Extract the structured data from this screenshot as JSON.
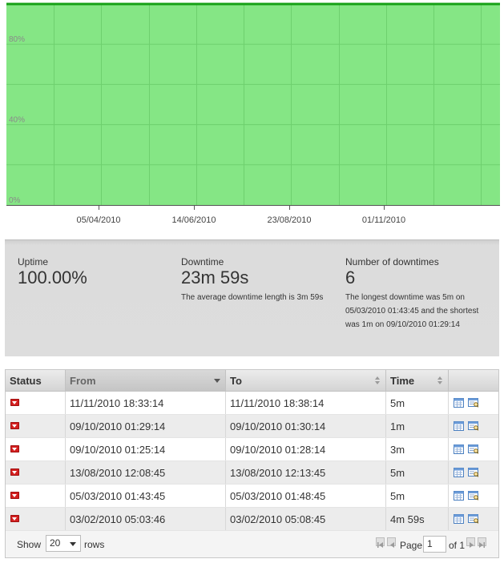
{
  "chart_data": {
    "type": "area",
    "x": [
      "start",
      "end"
    ],
    "series": [
      {
        "values": [
          100,
          100
        ]
      }
    ],
    "ylim": [
      0,
      100
    ],
    "y_ticks": [
      "0%",
      "40%",
      "80%"
    ],
    "x_ticks": [
      "05/04/2010",
      "14/06/2010",
      "23/08/2010",
      "01/11/2010"
    ],
    "grid": true,
    "colors": {
      "fill": "#85e685",
      "line": "#16a016",
      "grid": "#6ed06e"
    }
  },
  "stats": {
    "uptime": {
      "label": "Uptime",
      "value": "100.00%"
    },
    "downtime": {
      "label": "Downtime",
      "value": "23m 59s",
      "desc": "The average downtime length is 3m 59s"
    },
    "downtimes": {
      "label": "Number of downtimes",
      "value": "6",
      "desc": "The longest downtime was 5m on 05/03/2010 01:43:45 and the shortest was 1m on 09/10/2010 01:29:14"
    }
  },
  "table": {
    "headers": {
      "status": "Status",
      "from": "From",
      "to": "To",
      "time": "Time"
    },
    "rows": [
      {
        "from": "11/11/2010 18:33:14",
        "to": "11/11/2010 18:38:14",
        "time": "5m"
      },
      {
        "from": "09/10/2010 01:29:14",
        "to": "09/10/2010 01:30:14",
        "time": "1m"
      },
      {
        "from": "09/10/2010 01:25:14",
        "to": "09/10/2010 01:28:14",
        "time": "3m"
      },
      {
        "from": "13/08/2010 12:08:45",
        "to": "13/08/2010 12:13:45",
        "time": "5m"
      },
      {
        "from": "05/03/2010 01:43:45",
        "to": "05/03/2010 01:48:45",
        "time": "5m"
      },
      {
        "from": "03/02/2010 05:03:46",
        "to": "03/02/2010 05:08:45",
        "time": "4m 59s"
      }
    ],
    "status_icon": "down-arrow-red-icon",
    "status_color": "#d42020",
    "row_action_icons": [
      "calendar-icon",
      "log-search-icon"
    ]
  },
  "footer": {
    "show_label": "Show",
    "rows_value": "20",
    "rows_label": "rows",
    "page_label": "Page",
    "page_value": "1",
    "of_label": "of 1"
  }
}
